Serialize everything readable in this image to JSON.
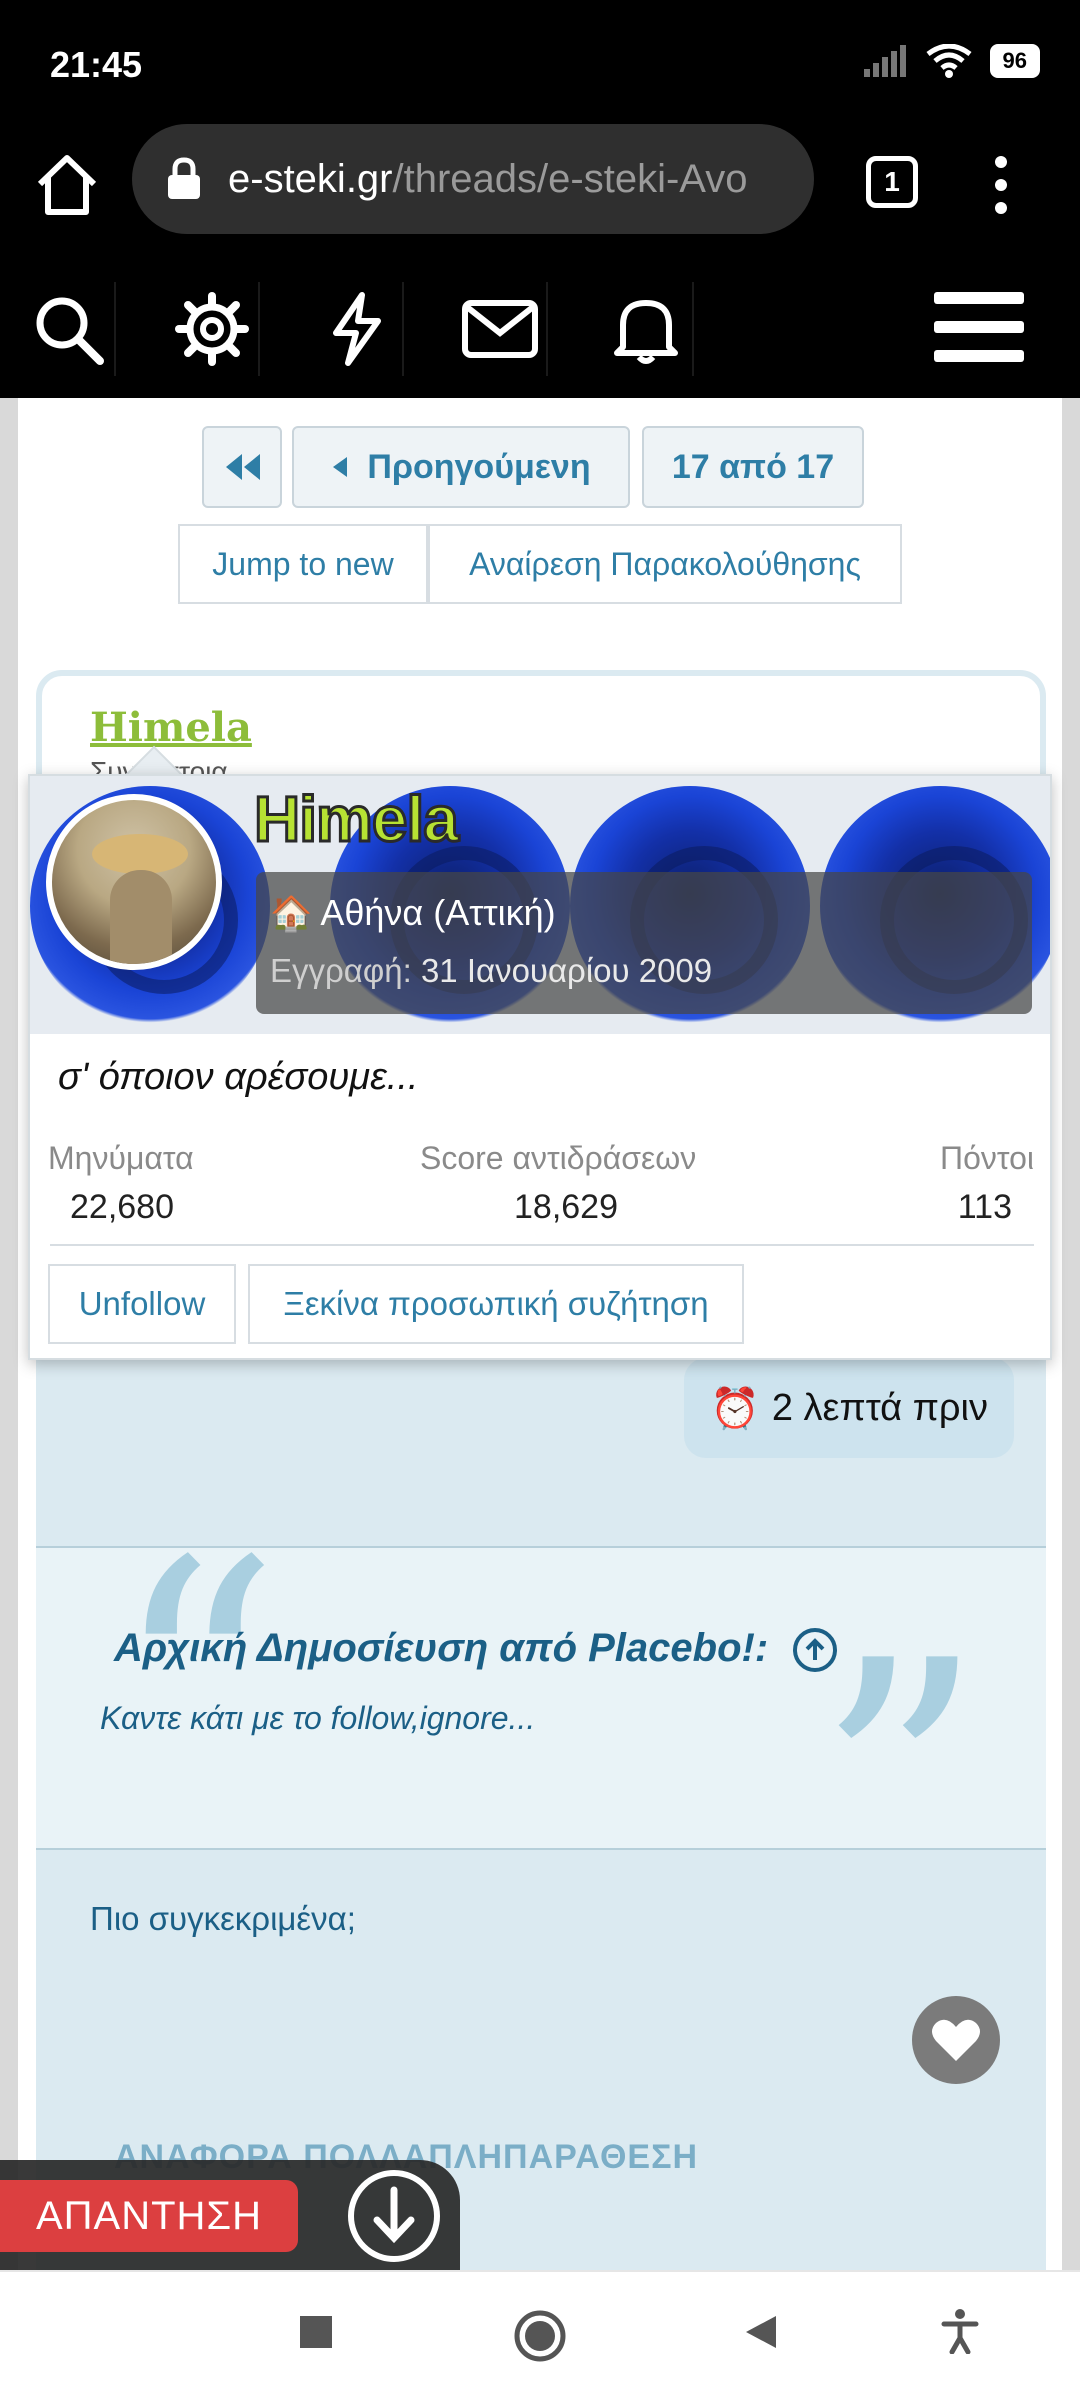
{
  "status_bar": {
    "time": "21:45",
    "battery": "96"
  },
  "browser": {
    "url_host": "e-steki.gr",
    "url_path": "/threads/e-steki-Avo",
    "tab_count": "1"
  },
  "site_nav": {
    "icons": [
      "search-icon",
      "gear-icon",
      "lightning-icon",
      "mail-icon",
      "bell-icon",
      "hamburger-menu-icon"
    ]
  },
  "pagination": {
    "prev_label": "Προηγούμενη",
    "page_label": "17 από 17",
    "jump_label": "Jump to new",
    "unwatch_label": "Αναίρεση Παρακολούθησης"
  },
  "post": {
    "author": "Himela",
    "author_sub": "Συντ  ίστοια",
    "time_ago": "2 λεπτά πριν",
    "quote_title": "Αρχική Δημοσίευση από Placebo!:",
    "quote_body": "Καντε κάτι με το follow,ignore...",
    "body": "Πιο συγκεκριμένα;",
    "faded_actions": "ΑΝΑΦΟΡΑ  ΠΟΛΛΑΠΛΗΠΑΡΑΘΕΣΗ"
  },
  "profile_card": {
    "name": "Himela",
    "location": "Αθήνα (Αττική)",
    "registration_label": "Εγγραφή:",
    "registration_date": "31 Ιανουαρίου 2009",
    "motto": "σ' όποιον αρέσουμε...",
    "stats": {
      "messages_label": "Μηνύματα",
      "messages_value": "22,680",
      "reactions_label": "Score αντιδράσεων",
      "reactions_value": "18,629",
      "points_label": "Πόντοι",
      "points_value": "113"
    },
    "unfollow_label": "Unfollow",
    "conversation_label": "Ξεκίνα προσωπική συζήτηση"
  },
  "reply": {
    "label": "ΑΠΑΝΤΗΣΗ"
  },
  "colors": {
    "accent": "#2e7ea6",
    "reply_red": "#dc3f40",
    "name_green": "#b7e233",
    "post_bg": "#dbeaf1"
  }
}
